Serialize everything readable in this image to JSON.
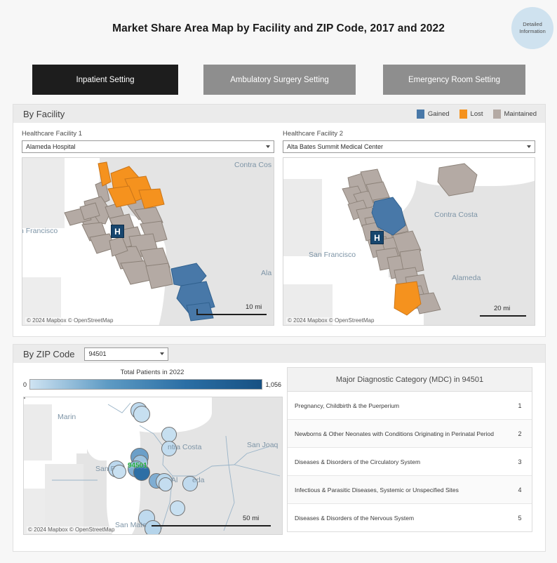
{
  "header": {
    "title": "Market Share Area Map by Facility and ZIP Code, 2017 and 2022",
    "badge_line1": "Detailed",
    "badge_line2": "Information"
  },
  "tabs": [
    {
      "id": "inpatient",
      "label": "Inpatient Setting",
      "active": true
    },
    {
      "id": "ambulatory",
      "label": "Ambulatory Surgery Setting",
      "active": false
    },
    {
      "id": "emergency",
      "label": "Emergency Room Setting",
      "active": false
    }
  ],
  "facility_panel": {
    "title": "By Facility",
    "legend": [
      {
        "label": "Gained",
        "color": "#4878a8"
      },
      {
        "label": "Lost",
        "color": "#f5921e"
      },
      {
        "label": "Maintained",
        "color": "#b4aaa4"
      }
    ],
    "facility_1": {
      "field_label": "Healthcare Facility 1",
      "selected": "Alameda Hospital",
      "map": {
        "scale_label": "10 mi",
        "attribution": "© 2024 Mapbox  © OpenStreetMap",
        "marker": "H",
        "place_labels": [
          "Contra Cos",
          "n Francisco",
          "Ala"
        ]
      }
    },
    "facility_2": {
      "field_label": "Healthcare Facility 2",
      "selected": "Alta Bates Summit Medical Center",
      "map": {
        "scale_label": "20 mi",
        "attribution": "© 2024 Mapbox  © OpenStreetMap",
        "marker": "H",
        "place_labels": [
          "Contra Costa",
          "San Francisco",
          "Alameda"
        ]
      }
    }
  },
  "zip_panel": {
    "title": "By ZIP Code",
    "selected_zip": "94501",
    "legend": {
      "title": "Total Patients in 2022",
      "min": "0",
      "max": "1,056",
      "gradient_start": "#cfe3f2",
      "gradient_end": "#185183"
    },
    "map": {
      "scale_label": "50 mi",
      "attribution": "© 2024 Mapbox  © OpenStreetMap",
      "callout": "94501",
      "place_labels": [
        "Marin",
        "ntra Costa",
        "San Joaq",
        "San F",
        "Al",
        "eda",
        "San Mate"
      ]
    },
    "mdc_table": {
      "header": "Major Diagnostic Category (MDC) in 94501",
      "rows": [
        {
          "category": "Pregnancy, Childbirth & the Puerperium",
          "rank": "1"
        },
        {
          "category": "Newborns & Other Neonates with Conditions Originating in Perinatal Period",
          "rank": "2"
        },
        {
          "category": "Diseases & Disorders of the Circulatory System",
          "rank": "3"
        },
        {
          "category": "Infectious & Parasitic Diseases, Systemic or Unspecified Sites",
          "rank": "4"
        },
        {
          "category": "Diseases & Disorders of the Nervous System",
          "rank": "5"
        }
      ]
    }
  }
}
